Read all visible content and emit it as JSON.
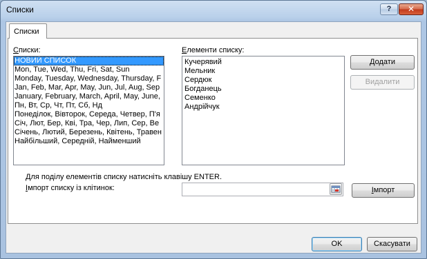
{
  "window": {
    "title": "Списки",
    "help_label": "?",
    "close_label": "✕"
  },
  "tab": {
    "label": "Списки"
  },
  "lists_panel": {
    "label_accel": "С",
    "label_rest": "писки:",
    "items": [
      "НОВИЙ СПИСОК",
      "Mon, Tue, Wed, Thu, Fri, Sat, Sun",
      "Monday, Tuesday, Wednesday, Thursday, F",
      "Jan, Feb, Mar, Apr, May, Jun, Jul, Aug, Sep",
      "January, February, March, April, May, June,",
      "Пн, Вт, Ср, Чт, Пт, Сб, Нд",
      "Понеділок, Вівторок, Середа, Четвер, П'я",
      "Січ, Лют, Бер, Кві, Тра, Чер, Лип, Сер, Ве",
      "Січень, Лютий, Березень, Квітень, Травен",
      "Найбільший, Середній, Найменший"
    ],
    "selected_index": 0
  },
  "entries_panel": {
    "label_accel": "Е",
    "label_rest": "лементи списку:",
    "lines": [
      "Кучерявий",
      "Мельник",
      "Сердюк",
      "Богданець",
      "Семенко",
      "Андрійчук"
    ]
  },
  "buttons": {
    "add_accel": "Д",
    "add_rest": "одати",
    "delete_label": "Видалити",
    "import_accel": "І",
    "import_rest": "мпорт",
    "ok_label": "OK",
    "cancel_label": "Скасувати"
  },
  "import": {
    "hint": "Для поділу елементів списку натисніть клавішу ENTER.",
    "label_accel": "І",
    "label_rest": "мпорт списку із клітинок:",
    "value": ""
  },
  "colors": {
    "selection": "#3399ff",
    "title_bar": "#b9d0ea",
    "close_button": "#c0391b"
  }
}
